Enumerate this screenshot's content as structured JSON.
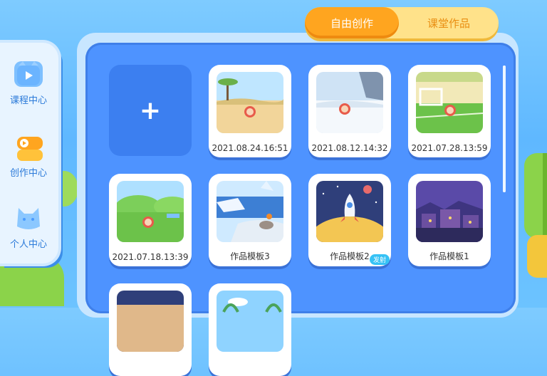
{
  "tabs": [
    {
      "label": "自由创作",
      "active": true
    },
    {
      "label": "课堂作品",
      "active": false
    }
  ],
  "sidebar": {
    "items": [
      {
        "label": "课程中心",
        "icon": "video-icon"
      },
      {
        "label": "创作中心",
        "icon": "play-stack-icon",
        "active": true
      },
      {
        "label": "个人中心",
        "icon": "cat-face-icon"
      }
    ]
  },
  "works": {
    "new_label": "+",
    "items": [
      {
        "label": "2021.08.24.16:51",
        "scene": "savanna"
      },
      {
        "label": "2021.08.12.14:32",
        "scene": "snow"
      },
      {
        "label": "2021.07.28.13:59",
        "scene": "soccer"
      },
      {
        "label": "2021.07.18.13:39",
        "scene": "meadow"
      },
      {
        "label": "作品模板3",
        "scene": "iceberg"
      },
      {
        "label": "作品模板2",
        "scene": "rocket",
        "badge": "发射"
      },
      {
        "label": "作品模板1",
        "scene": "night-town"
      }
    ]
  },
  "colors": {
    "accent_orange": "#ffa51f",
    "panel_blue": "#4e93ff",
    "nav_text": "#2b7ad9"
  }
}
